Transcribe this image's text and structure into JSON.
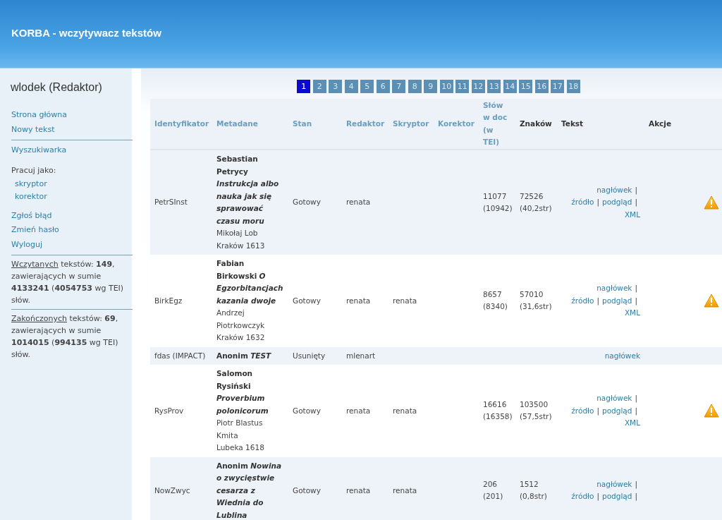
{
  "header": {
    "title": "KORBA - wczytywacz tekstów"
  },
  "sidebar": {
    "user": "wlodek (Redaktor)",
    "groups": [
      {
        "kind": "links",
        "items": [
          {
            "label": "Strona główna"
          },
          {
            "label": "Nowy tekst"
          }
        ]
      },
      {
        "kind": "links",
        "items": [
          {
            "label": "Wyszukiwarka"
          }
        ]
      },
      {
        "kind": "roles",
        "heading": "Pracuj jako:",
        "items": [
          {
            "label": "skryptor"
          },
          {
            "label": "korektor"
          }
        ]
      },
      {
        "kind": "links",
        "items": [
          {
            "label": "Zgłoś błąd"
          },
          {
            "label": "Zmień hasło"
          },
          {
            "label": "Wyloguj"
          }
        ]
      },
      {
        "kind": "stat",
        "link": "Wczytanych",
        "text": "tekstów: **149**, zawierających w sumie **4133241** (**4054753** wg TEI) słów."
      },
      {
        "kind": "stat",
        "link": "Zakończonych",
        "text": "tekstów: **69**, zawierających w sumie **1014015** (**994135** wg TEI) słów."
      }
    ]
  },
  "pager": [
    {
      "label": "1",
      "selected": true
    },
    {
      "label": "2",
      "selected": false
    },
    {
      "label": "3",
      "selected": false
    },
    {
      "label": "4",
      "selected": false
    },
    {
      "label": "5",
      "selected": false
    },
    {
      "label": "6",
      "selected": false
    },
    {
      "label": "7",
      "selected": false
    },
    {
      "label": "8",
      "selected": false
    },
    {
      "label": "9",
      "selected": false
    },
    {
      "label": "10",
      "selected": false
    },
    {
      "label": "11",
      "selected": false
    },
    {
      "label": "12",
      "selected": false
    },
    {
      "label": "13",
      "selected": false
    },
    {
      "label": "14",
      "selected": false
    },
    {
      "label": "15",
      "selected": false
    },
    {
      "label": "16",
      "selected": false
    },
    {
      "label": "17",
      "selected": false
    },
    {
      "label": "18",
      "selected": false
    }
  ],
  "table": {
    "separator": "|",
    "columns": [
      {
        "label": "Identyfikator",
        "sortable": true
      },
      {
        "label": "Metadane",
        "sortable": true
      },
      {
        "label": "Stan",
        "sortable": true
      },
      {
        "label": "Redaktor",
        "sortable": true
      },
      {
        "label": "Skryptor",
        "sortable": true
      },
      {
        "label": "Korektor",
        "sortable": true
      },
      {
        "label": "Słów w doc (w TEI)",
        "sortable": true
      },
      {
        "label": "Znaków",
        "sortable": false
      },
      {
        "label": "Tekst",
        "sortable": false
      },
      {
        "label": "Akcje",
        "sortable": false
      }
    ],
    "rows": [
      {
        "id": "PetrSInst",
        "author": "Sebastian Petrycy",
        "title": "Instrukcja albo nauka jak się sprawować czasu moru",
        "printer": "Mikołaj Lob",
        "place": "Kraków 1613",
        "state": "Gotowy",
        "editor": "renata",
        "scriptor": "",
        "words": "11077",
        "words_tei": "(10942)",
        "chars": "72526",
        "pages": "(40,2str)",
        "links": [
          {
            "label": "nagłówek"
          },
          {
            "label": "źródło"
          },
          {
            "label": "podgląd"
          },
          {
            "label": "XML"
          }
        ],
        "warning": true
      },
      {
        "id": "BirkEgz",
        "author": "Fabian Birkowski",
        "title": "O Egzorbitancjach kazania dwoje",
        "printer": "Andrzej Piotrkowczyk",
        "place": "Kraków 1632",
        "state": "Gotowy",
        "editor": "renata",
        "scriptor": "renata",
        "words": "8657",
        "words_tei": "(8340)",
        "chars": "57010",
        "pages": "(31,6str)",
        "links": [
          {
            "label": "nagłówek"
          },
          {
            "label": "źródło"
          },
          {
            "label": "podgląd"
          },
          {
            "label": "XML"
          }
        ],
        "warning": true
      },
      {
        "id": "fdas (IMPACT)",
        "author": "Anonim",
        "title": "TEST",
        "state": "Usunięty",
        "editor": "mlenart",
        "scriptor": "",
        "links": [
          {
            "label": "nagłówek"
          }
        ],
        "warning": false
      },
      {
        "id": "RysProv",
        "author": "Salomon Rysiński",
        "title": "Proverbium polonicorum",
        "printer": "Piotr Blastus Kmita",
        "place": "Lubeka 1618",
        "state": "Gotowy",
        "editor": "renata",
        "scriptor": "renata",
        "words": "16616",
        "words_tei": "(16358)",
        "chars": "103500",
        "pages": "(57,5str)",
        "links": [
          {
            "label": "nagłówek"
          },
          {
            "label": "źródło"
          },
          {
            "label": "podgląd"
          },
          {
            "label": "XML"
          }
        ],
        "warning": true
      },
      {
        "id": "NowZwyc",
        "author": "Anonim",
        "title": "Nowina o zwycięstwie cesarza z Wiednia do Lublina",
        "state": "Gotowy",
        "editor": "renata",
        "scriptor": "renata",
        "words": "206",
        "words_tei": "(201)",
        "chars": "1512",
        "pages": "(0,8str)",
        "links": [
          {
            "label": "nagłówek"
          },
          {
            "label": "źródło"
          },
          {
            "label": "podgląd"
          }
        ],
        "warning": false
      }
    ]
  }
}
